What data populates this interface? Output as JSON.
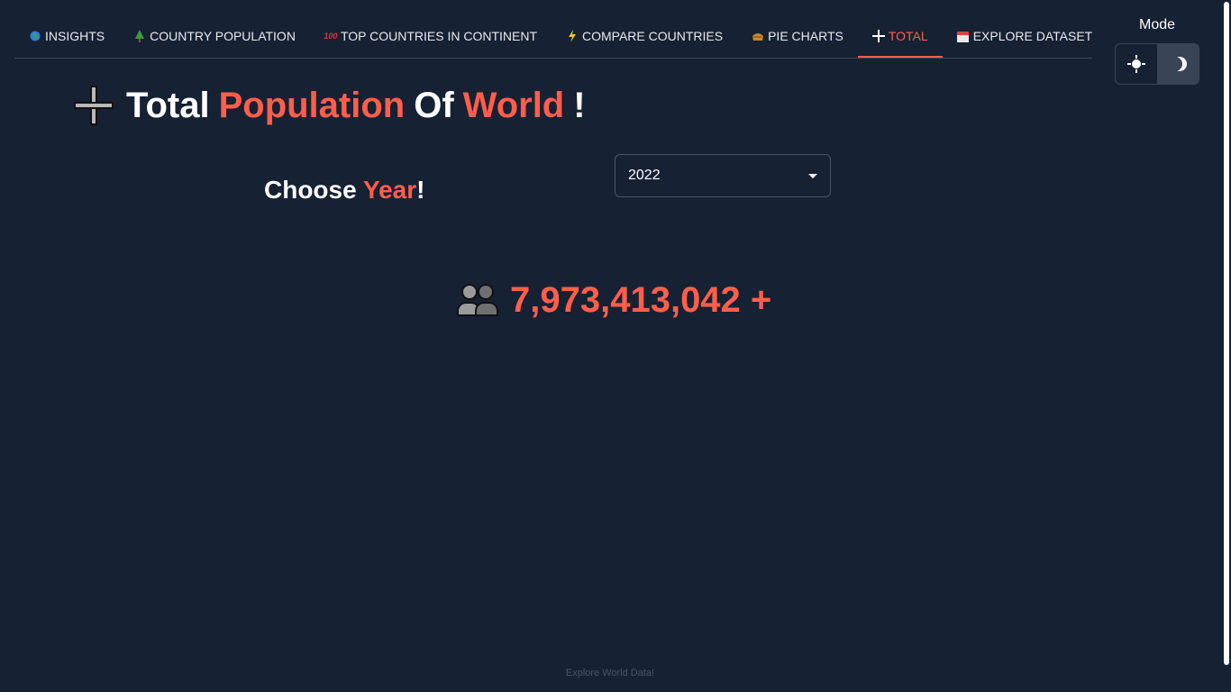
{
  "tabs": [
    {
      "icon": "globe-icon",
      "label": "INSIGHTS",
      "active": false
    },
    {
      "icon": "tree-icon",
      "label": "COUNTRY POPULATION",
      "active": false
    },
    {
      "icon": "hundred-icon",
      "label": "TOP COUNTRIES IN CONTINENT",
      "active": false
    },
    {
      "icon": "lightning-icon",
      "label": "COMPARE COUNTRIES",
      "active": false
    },
    {
      "icon": "pie-icon",
      "label": "PIE CHARTS",
      "active": false
    },
    {
      "icon": "plus-icon",
      "label": "TOTAL",
      "active": true
    },
    {
      "icon": "calendar-icon",
      "label": "EXPLORE DATASET",
      "active": false
    }
  ],
  "mode": {
    "label": "Mode",
    "selected": "dark"
  },
  "heading": {
    "w1": "Total",
    "w2": "Population",
    "w3": "Of",
    "w4": "World",
    "w5": "!"
  },
  "choose": {
    "w1": "Choose",
    "w2": "Year",
    "w3": "!"
  },
  "year_select": {
    "value": "2022"
  },
  "total": {
    "value": "7,973,413,042 +"
  },
  "footer": {
    "text": "Explore World Data!"
  },
  "colors": {
    "accent": "#ff5e4b",
    "background": "#172134"
  }
}
